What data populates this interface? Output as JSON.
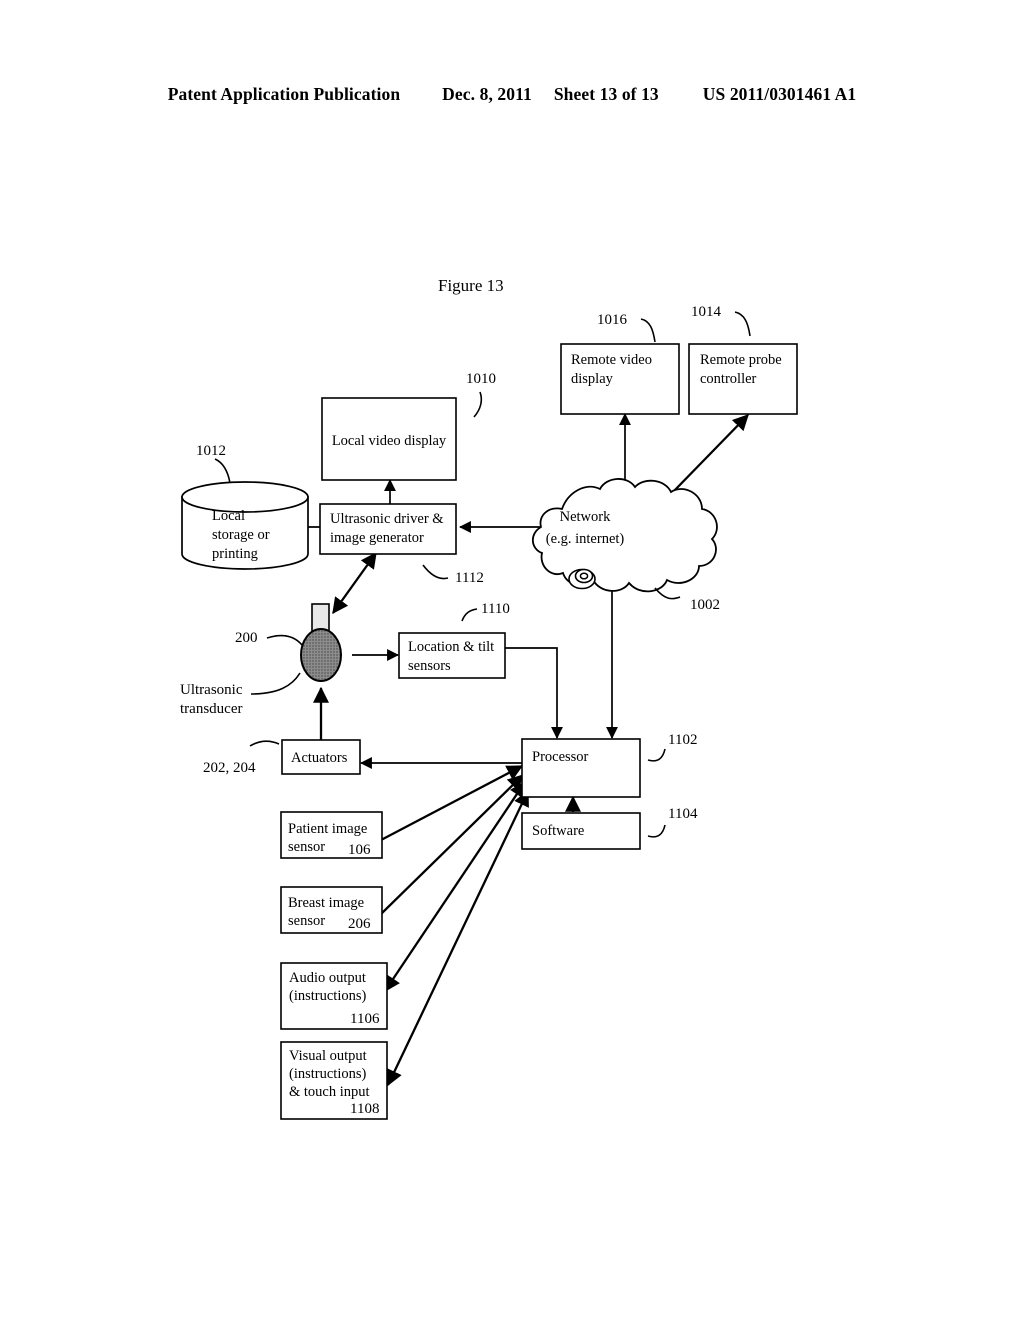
{
  "header": {
    "publication": "Patent Application Publication",
    "date": "Dec. 8, 2011",
    "sheet": "Sheet 13 of 13",
    "patent_number": "US 2011/0301461 A1"
  },
  "figure": {
    "title": "Figure 13"
  },
  "nodes": {
    "remote_video_display": {
      "label_line1": "Remote video",
      "label_line2": "display",
      "ref": "1016"
    },
    "remote_probe_controller": {
      "label_line1": "Remote probe",
      "label_line2": "controller",
      "ref": "1014"
    },
    "local_video_display": {
      "label": "Local video display",
      "ref": "1010"
    },
    "local_storage": {
      "label_line1": "Local",
      "label_line2": "storage or",
      "label_line3": "printing",
      "ref": "1012"
    },
    "ultrasonic_driver": {
      "label_line1": "Ultrasonic driver &",
      "label_line2": "image generator",
      "ref": "1112"
    },
    "network": {
      "label_line1": "Network",
      "label_line2": "(e.g. internet)",
      "ref": "1002"
    },
    "ultrasonic_transducer": {
      "label_line1": "Ultrasonic",
      "label_line2": "transducer",
      "ref": "200"
    },
    "location_tilt_sensors": {
      "label_line1": "Location & tilt",
      "label_line2": "sensors",
      "ref": "1110"
    },
    "processor": {
      "label": "Processor",
      "ref": "1102"
    },
    "software": {
      "label": "Software",
      "ref": "1104"
    },
    "actuators": {
      "label": "Actuators",
      "ref": "202, 204"
    },
    "patient_image_sensor": {
      "label_line1": "Patient image",
      "label_line2": "sensor",
      "ref": "106"
    },
    "breast_image_sensor": {
      "label_line1": "Breast image",
      "label_line2": "sensor",
      "ref": "206"
    },
    "audio_output": {
      "label_line1": "Audio output",
      "label_line2": "(instructions)",
      "ref": "1106"
    },
    "visual_output": {
      "label_line1": "Visual output",
      "label_line2": "(instructions)",
      "label_line3": "& touch input",
      "ref": "1108"
    }
  },
  "chart_data": {
    "type": "diagram",
    "title": "Figure 13",
    "blocks": [
      {
        "id": "1016",
        "name": "Remote video display"
      },
      {
        "id": "1014",
        "name": "Remote probe controller"
      },
      {
        "id": "1010",
        "name": "Local video display"
      },
      {
        "id": "1012",
        "name": "Local storage or printing"
      },
      {
        "id": "1112",
        "name": "Ultrasonic driver & image generator"
      },
      {
        "id": "1002",
        "name": "Network (e.g. internet)"
      },
      {
        "id": "200",
        "name": "Ultrasonic transducer"
      },
      {
        "id": "1110",
        "name": "Location & tilt sensors"
      },
      {
        "id": "1102",
        "name": "Processor"
      },
      {
        "id": "1104",
        "name": "Software"
      },
      {
        "id": "202, 204",
        "name": "Actuators"
      },
      {
        "id": "106",
        "name": "Patient image sensor"
      },
      {
        "id": "206",
        "name": "Breast image sensor"
      },
      {
        "id": "1106",
        "name": "Audio output (instructions)"
      },
      {
        "id": "1108",
        "name": "Visual output (instructions) & touch input"
      }
    ],
    "edges": [
      {
        "from": "1002",
        "to": "1016",
        "direction": "one-way"
      },
      {
        "from": "1002",
        "to": "1014",
        "direction": "one-way"
      },
      {
        "from": "1002",
        "to": "1112",
        "direction": "one-way"
      },
      {
        "from": "1002",
        "to": "1102",
        "direction": "one-way"
      },
      {
        "from": "1112",
        "to": "1010",
        "direction": "one-way"
      },
      {
        "from": "1112",
        "to": "1012",
        "direction": "one-way"
      },
      {
        "from": "1112",
        "to": "200",
        "direction": "two-way"
      },
      {
        "from": "200",
        "to": "1110",
        "direction": "one-way"
      },
      {
        "from": "1110",
        "to": "1102",
        "direction": "one-way"
      },
      {
        "from": "1102",
        "to": "202, 204",
        "direction": "one-way"
      },
      {
        "from": "202, 204",
        "to": "200",
        "direction": "one-way"
      },
      {
        "from": "1104",
        "to": "1102",
        "direction": "one-way"
      },
      {
        "from": "106",
        "to": "1102",
        "direction": "one-way"
      },
      {
        "from": "206",
        "to": "1102",
        "direction": "one-way"
      },
      {
        "from": "1106",
        "to": "1102",
        "direction": "two-way"
      },
      {
        "from": "1108",
        "to": "1102",
        "direction": "two-way"
      }
    ]
  }
}
